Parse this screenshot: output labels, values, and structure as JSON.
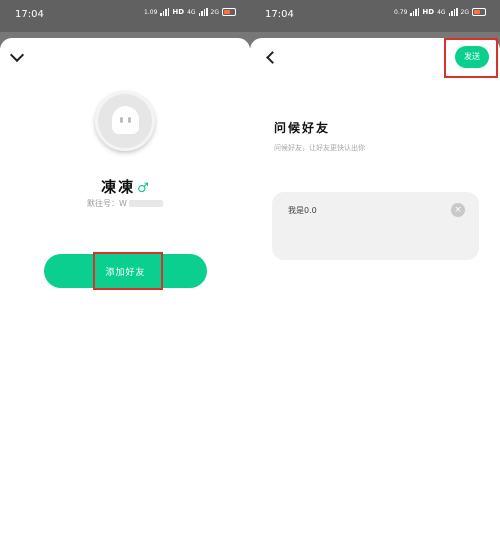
{
  "status_bar": {
    "time": "17:04",
    "left_speed": "1.09",
    "right_speed": "0.79",
    "speed_unit": "K/s",
    "hd_label": "HD",
    "network": "4G",
    "network_bottom": "2G"
  },
  "profile": {
    "nickname": "凍凍",
    "gender_symbol": "♂",
    "id_prefix": "默往号：W"
  },
  "actions": {
    "add_friend_label": "添加好友"
  },
  "greet": {
    "title": "问候好友",
    "subtitle": "问候好友，让好友更快认出你",
    "message": "我是0.0",
    "send_label": "发送",
    "clear_symbol": "×"
  },
  "colors": {
    "accent": "#0bcf8e",
    "highlight": "#d9322d",
    "status_bar": "#616161"
  }
}
